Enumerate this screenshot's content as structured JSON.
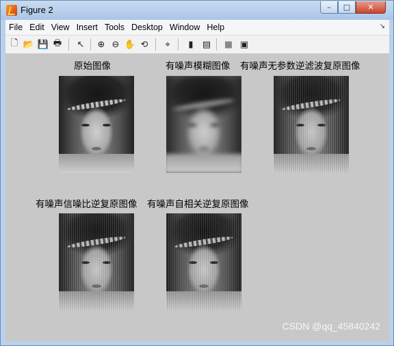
{
  "window": {
    "title": "Figure 2",
    "buttons": {
      "minimize": "–",
      "maximize": "□",
      "close": "✕"
    }
  },
  "menubar": {
    "items": [
      "File",
      "Edit",
      "View",
      "Insert",
      "Tools",
      "Desktop",
      "Window",
      "Help"
    ],
    "arrow": "↘"
  },
  "toolbar": {
    "icons": [
      "new-figure-icon",
      "open-file-icon",
      "save-icon",
      "print-icon",
      "edit-plot-arrow-icon",
      "zoom-in-icon",
      "zoom-out-icon",
      "pan-hand-icon",
      "rotate-3d-icon",
      "data-cursor-icon",
      "colorbar-icon",
      "legend-icon",
      "hide-plot-tools-icon",
      "show-plot-tools-icon"
    ],
    "glyphs": [
      "🗋",
      "📂",
      "💾",
      "🖶",
      "↖",
      "⊕",
      "⊖",
      "✋",
      "⟲",
      "⌖",
      "▮",
      "▤",
      "■",
      "▣"
    ]
  },
  "figure": {
    "titles": [
      "原始图像",
      "有噪声模糊图像",
      "有噪声无参数逆滤波复原图像",
      "有噪声信噪比逆复原图像",
      "有噪声自相关逆复原图像"
    ]
  },
  "watermark": "CSDN @qq_45840242"
}
